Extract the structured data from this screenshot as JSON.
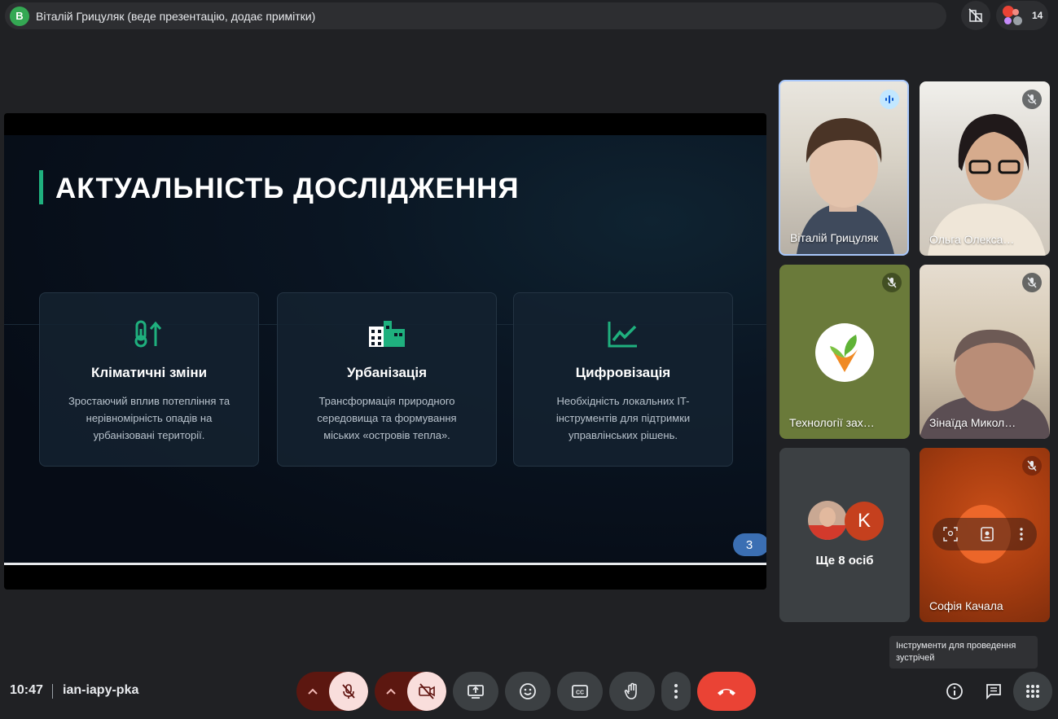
{
  "top_bar": {
    "presenter_initial": "В",
    "presenter_text": "Віталій Грицуляк (веде презентацію, додає примітки)",
    "participant_count": "14"
  },
  "slide": {
    "title": "АКТУАЛЬНІСТЬ ДОСЛІДЖЕННЯ",
    "accent_color": "#1fb07e",
    "page_number": "3",
    "cards": [
      {
        "icon": "thermometer-up-icon",
        "title": "Кліматичні зміни",
        "text": "Зростаючий вплив потепління та нерівномірність опадів на урбанізовані території."
      },
      {
        "icon": "city-buildings-icon",
        "title": "Урбанізація",
        "text": "Трансформація природного середовища та формування міських «островів тепла»."
      },
      {
        "icon": "trending-chart-icon",
        "title": "Цифровізація",
        "text": "Необхідність локальних IT-інструментів для підтримки управлінських рішень."
      }
    ]
  },
  "participants": [
    {
      "name": "Віталій Грицуляк",
      "state": "speaking"
    },
    {
      "name": "Ольга Олекса…",
      "state": "muted"
    },
    {
      "name": "Технології зах…",
      "state": "muted"
    },
    {
      "name": "Зінаїда Микол…",
      "state": "muted"
    },
    {
      "name": "Ще 8 осіб",
      "initial": "K"
    },
    {
      "name": "Софія Качала",
      "state": "muted"
    }
  ],
  "tooltip": "Інструменти для проведення зустрічей",
  "bottom_bar": {
    "time": "10:47",
    "meeting_code": "ian-iapy-pka"
  }
}
